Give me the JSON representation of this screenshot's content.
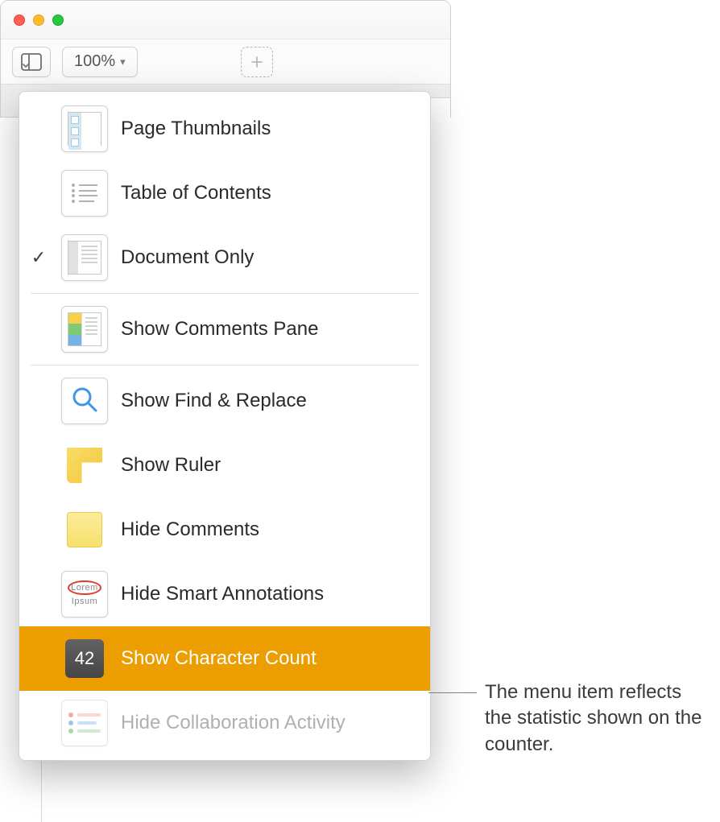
{
  "toolbar": {
    "zoom": "100%"
  },
  "menu": {
    "items": {
      "page_thumbnails": "Page Thumbnails",
      "table_of_contents": "Table of Contents",
      "document_only": "Document Only",
      "show_comments_pane": "Show Comments Pane",
      "show_find_replace": "Show Find & Replace",
      "show_ruler": "Show Ruler",
      "hide_comments": "Hide Comments",
      "hide_smart_annotations": "Hide Smart Annotations",
      "show_character_count": "Show Character Count",
      "hide_collaboration_activity": "Hide Collaboration Activity"
    },
    "count_icon_value": "42"
  },
  "callout": "The menu item reflects the statistic shown on the counter."
}
